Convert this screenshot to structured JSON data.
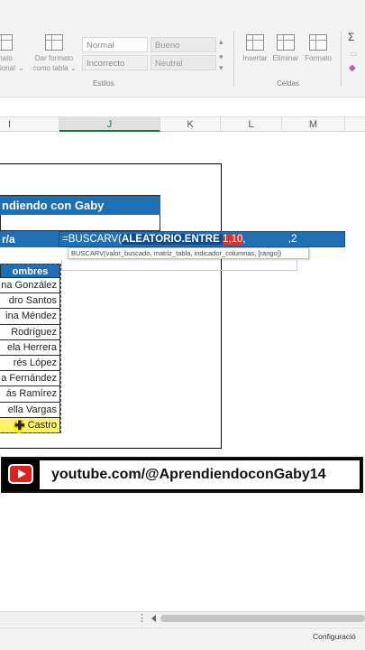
{
  "ribbon": {
    "format_partial": "mato",
    "format_partial2": "cional",
    "give_format_label1": "Dar formato",
    "give_format_label2": "como tabla",
    "styles": [
      "Normal",
      "Bueno",
      "Incorrecto",
      "Neutral"
    ],
    "styles_group": "Estilos",
    "insert": "Insertar",
    "delete": "Eliminar",
    "format": "Formato",
    "cells_group": "Celdas",
    "sigma": "Σ"
  },
  "columns": [
    "I",
    "J",
    "K",
    "L",
    "M"
  ],
  "sheet": {
    "title": "ndiendo con Gaby",
    "na_cell": "r/a",
    "formula": {
      "prefix": "=BUSCARV(",
      "func": "ALEATORIO.ENTRE",
      "args": "1,10",
      "sep": ",",
      "dim": "   ",
      "suffix": ",2"
    },
    "tooltip": "BUSCARV(valor_buscado, matriz_tabla, indicador_columnas, [rango])",
    "names_header": "ombres",
    "names": [
      "na González",
      "dro Santos",
      "ina Méndez",
      "Rodríguez",
      "ela Herrera",
      "rés López",
      "a Fernández",
      "ás Ramírez",
      "ella Vargas",
      "tiá Castro"
    ]
  },
  "banner": {
    "url": "youtube.com/@AprendiendoconGaby14"
  },
  "status": {
    "dots": "⋮",
    "config": "Configuració"
  },
  "colors": {
    "accent": "#1f6fb5",
    "excel_green": "#217346",
    "youtube_red": "#e0201d"
  }
}
